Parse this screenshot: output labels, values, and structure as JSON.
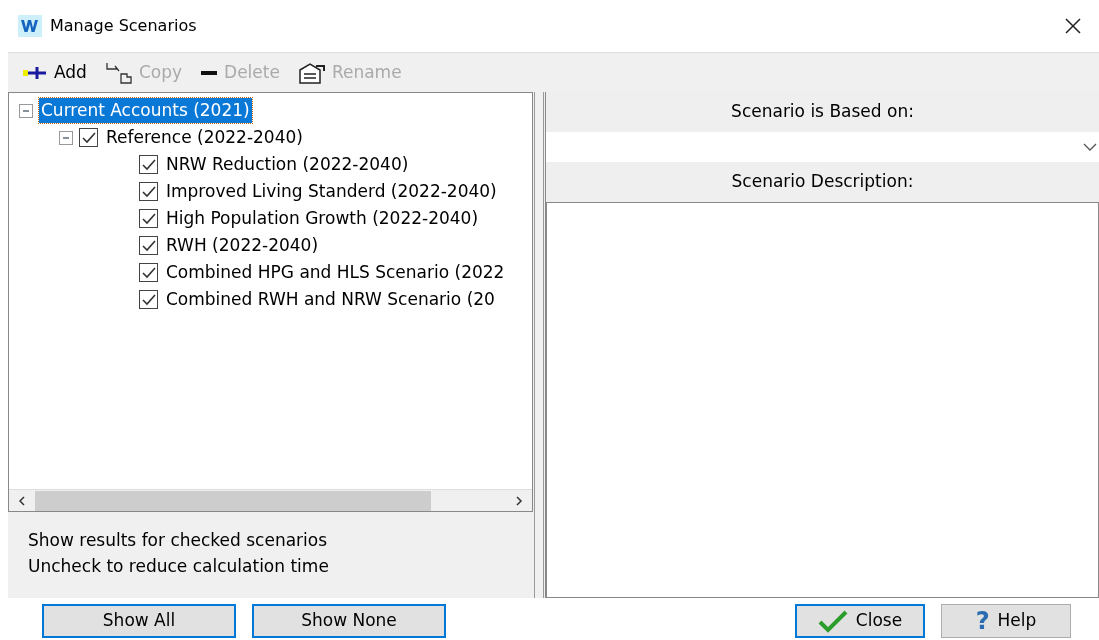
{
  "window": {
    "title": "Manage Scenarios"
  },
  "toolbar": [
    {
      "kind": "add",
      "label": "Add",
      "disabled": false
    },
    {
      "kind": "copy",
      "label": "Copy",
      "disabled": true
    },
    {
      "kind": "delete",
      "label": "Delete",
      "disabled": true
    },
    {
      "kind": "rename",
      "label": "Rename",
      "disabled": true
    }
  ],
  "tree": [
    {
      "label": "Current Accounts (2021)",
      "selected": true,
      "expanded": true,
      "children": [
        {
          "label": "Reference (2022-2040)",
          "selected": false,
          "checked": true,
          "expanded": true,
          "children": [
            {
              "label": "NRW Reduction (2022-2040)",
              "selected": false,
              "checked": true
            },
            {
              "label": "Improved Living Standerd (2022-2040)",
              "selected": false,
              "checked": true
            },
            {
              "label": "High Population Growth (2022-2040)",
              "selected": false,
              "checked": true
            },
            {
              "label": "RWH (2022-2040)",
              "selected": false,
              "checked": true
            },
            {
              "label": "Combined HPG and HLS Scenario (2022",
              "selected": false,
              "checked": true
            },
            {
              "label": "Combined RWH and NRW Scenario (20",
              "selected": false,
              "checked": true
            }
          ]
        }
      ]
    }
  ],
  "hint": [
    "Show results for checked scenarios",
    "Uncheck to reduce calculation time"
  ],
  "based_on": {
    "label": "Scenario is Based on:"
  },
  "description": {
    "label": "Scenario Description:"
  },
  "buttons": [
    {
      "kind": "plain",
      "label": "Show All"
    },
    {
      "kind": "plain",
      "label": "Show None"
    },
    {
      "kind": "close",
      "label": "Close"
    },
    {
      "kind": "help",
      "label": "Help",
      "icon": "?"
    }
  ]
}
